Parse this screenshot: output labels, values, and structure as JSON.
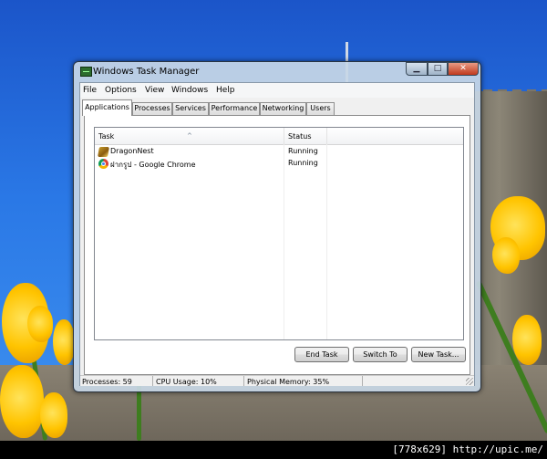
{
  "window": {
    "title": "Windows Task Manager",
    "minimize_symbol": "▁",
    "maximize_symbol": "□",
    "close_symbol": "✕"
  },
  "menu": [
    "File",
    "Options",
    "View",
    "Windows",
    "Help"
  ],
  "tabs": [
    "Applications",
    "Processes",
    "Services",
    "Performance",
    "Networking",
    "Users"
  ],
  "active_tab": "Applications",
  "list": {
    "columns": [
      "Task",
      "Status"
    ],
    "sort_indicator": "^",
    "rows": [
      {
        "task": "DragonNest",
        "status": "Running",
        "icon": "dragonnest-icon"
      },
      {
        "task": "ฝากรูป - Google Chrome",
        "status": "Running",
        "icon": "chrome-icon"
      }
    ]
  },
  "buttons": {
    "end_task": "End Task",
    "switch_to": "Switch To",
    "new_task": "New Task..."
  },
  "status_bar": {
    "processes": "Processes: 59",
    "cpu": "CPU Usage: 10%",
    "memory": "Physical Memory: 35%"
  },
  "watermark": "[778x629] http://upic.me/"
}
